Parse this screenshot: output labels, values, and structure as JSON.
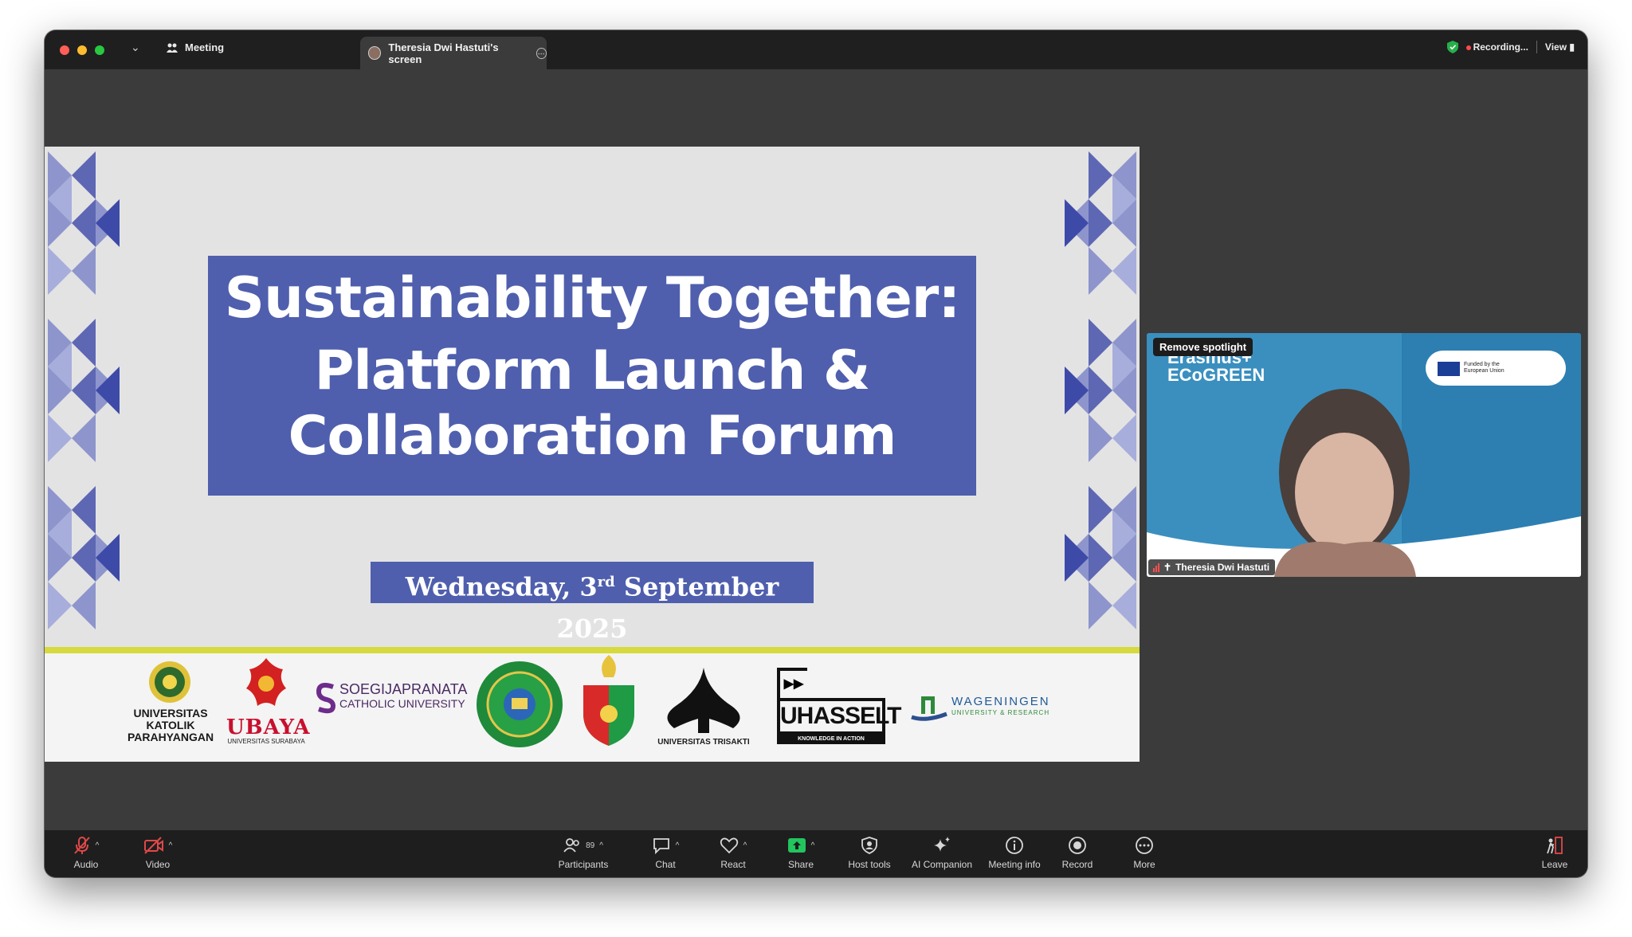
{
  "titlebar": {
    "meeting_label": "Meeting",
    "tab_label": "Theresia Dwi Hastuti's screen",
    "recording_label": "Recording...",
    "view_label": "View"
  },
  "slide": {
    "title_line1": "Sustainability Together:",
    "title_line2": "Platform Launch &",
    "title_line3": "Collaboration Forum",
    "date_prefix": "Wednesday, 3",
    "date_sup": "rd",
    "date_suffix": " September 2025",
    "logos": {
      "unpar": [
        "UNIVERSITAS",
        "KATOLIK",
        "PARAHYANGAN"
      ],
      "ubaya": "UBAYA",
      "ubaya_sub": "UNIVERSITAS SURABAYA",
      "soegija_1": "SOEGIJAPRANATA",
      "soegija_2": "CATHOLIC UNIVERSITY",
      "trisakti": "UNIVERSITAS TRISAKTI",
      "uhasselt": "UHASSELT",
      "uhasselt_sub": "KNOWLEDGE IN ACTION",
      "wageningen": "WAGENINGEN",
      "wageningen_sub": "UNIVERSITY & RESEARCH"
    }
  },
  "video": {
    "spotlight_label": "Remove spotlight",
    "participant_name": "Theresia Dwi Hastuti",
    "bg_title_1": "Erasmus+",
    "bg_title_2": "ECoGREEN",
    "badge_text": "Funded by the European Union"
  },
  "toolbar": {
    "audio": "Audio",
    "video": "Video",
    "participants": "Participants",
    "participants_count": "89",
    "chat": "Chat",
    "react": "React",
    "share": "Share",
    "host_tools": "Host tools",
    "ai_companion": "AI Companion",
    "meeting_info": "Meeting info",
    "record": "Record",
    "more": "More",
    "leave": "Leave"
  },
  "colors": {
    "slide_blue": "#4f5fad",
    "accent_yellow": "#d6da3c",
    "share_green": "#22c55e",
    "muted_red": "#ff4a4a"
  }
}
